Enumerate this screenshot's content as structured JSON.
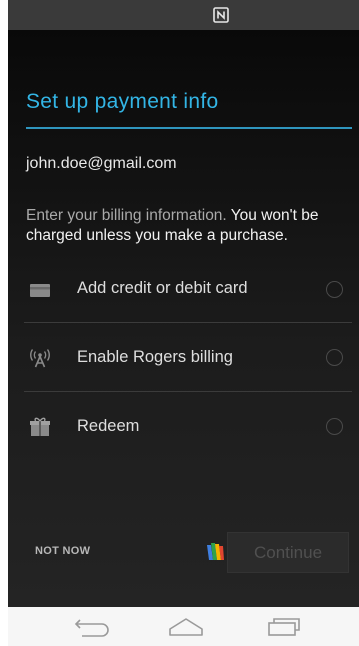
{
  "status_bar": {
    "nfc_icon": "nfc-icon"
  },
  "header": {
    "title": "Set up payment info"
  },
  "account": {
    "email": "john.doe@gmail.com"
  },
  "billing_info": {
    "prefix": "Enter your billing information. ",
    "emphasis": "You won't be charged unless you make a purchase."
  },
  "payment_options": [
    {
      "label": "Add credit or debit card",
      "icon": "credit-card-icon",
      "selected": false
    },
    {
      "label": "Enable Rogers billing",
      "icon": "carrier-tower-icon",
      "selected": false
    },
    {
      "label": "Redeem",
      "icon": "gift-icon",
      "selected": false
    }
  ],
  "footer": {
    "not_now_label": "NOT NOW",
    "wallet_icon": "google-wallet-icon",
    "continue_label": "Continue",
    "continue_enabled": false
  },
  "nav_bar": {
    "icons": [
      "back-icon",
      "home-icon",
      "recent-apps-icon"
    ]
  },
  "colors": {
    "accent": "#33b5e5",
    "background": "#121212",
    "nav_bar": "#f6f6f6"
  }
}
